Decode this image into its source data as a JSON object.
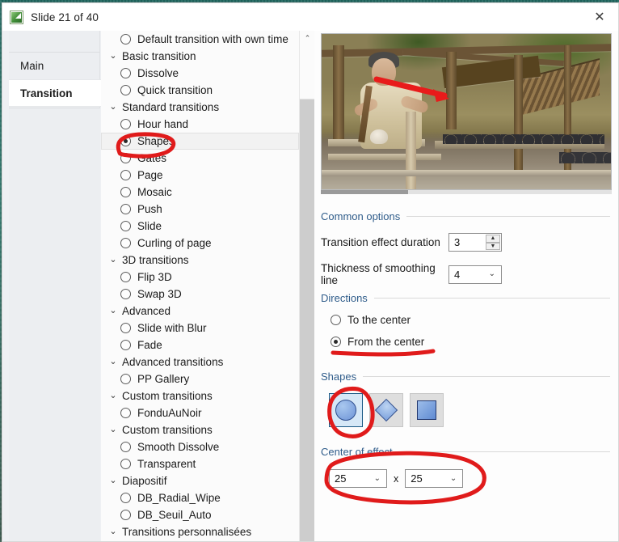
{
  "window": {
    "title": "Slide 21 of 40",
    "title_icon": "slide-thumbnail-icon",
    "close_label": "✕"
  },
  "tabs": [
    {
      "label": "Main",
      "active": false,
      "name": "tab-main"
    },
    {
      "label": "Transition",
      "active": true,
      "name": "tab-transition"
    }
  ],
  "tree": {
    "scroll_up_glyph": "⌃",
    "chevron_glyph": "⌄",
    "rows": [
      {
        "type": "item",
        "label": "Default transition with own time",
        "selected": false
      },
      {
        "type": "group",
        "label": "Basic transition"
      },
      {
        "type": "item",
        "label": "Dissolve",
        "selected": false
      },
      {
        "type": "item",
        "label": "Quick transition",
        "selected": false
      },
      {
        "type": "group",
        "label": "Standard transitions"
      },
      {
        "type": "item",
        "label": "Hour hand",
        "selected": false
      },
      {
        "type": "item",
        "label": "Shapes",
        "selected": true
      },
      {
        "type": "item",
        "label": "Gates",
        "selected": false
      },
      {
        "type": "item",
        "label": "Page",
        "selected": false
      },
      {
        "type": "item",
        "label": "Mosaic",
        "selected": false
      },
      {
        "type": "item",
        "label": "Push",
        "selected": false
      },
      {
        "type": "item",
        "label": "Slide",
        "selected": false
      },
      {
        "type": "item",
        "label": "Curling of page",
        "selected": false
      },
      {
        "type": "group",
        "label": "3D transitions"
      },
      {
        "type": "item",
        "label": "Flip 3D",
        "selected": false
      },
      {
        "type": "item",
        "label": "Swap 3D",
        "selected": false
      },
      {
        "type": "group",
        "label": "Advanced"
      },
      {
        "type": "item",
        "label": "Slide with Blur",
        "selected": false
      },
      {
        "type": "item",
        "label": "Fade",
        "selected": false
      },
      {
        "type": "group",
        "label": "Advanced transitions"
      },
      {
        "type": "item",
        "label": "PP Gallery",
        "selected": false
      },
      {
        "type": "group",
        "label": "Custom transitions"
      },
      {
        "type": "item",
        "label": "FonduAuNoir",
        "selected": false
      },
      {
        "type": "group",
        "label": "Custom transitions"
      },
      {
        "type": "item",
        "label": "Smooth Dissolve",
        "selected": false
      },
      {
        "type": "item",
        "label": "Transparent",
        "selected": false
      },
      {
        "type": "group",
        "label": "Diapositif"
      },
      {
        "type": "item",
        "label": "DB_Radial_Wipe",
        "selected": false
      },
      {
        "type": "item",
        "label": "DB_Seuil_Auto",
        "selected": false
      },
      {
        "type": "group",
        "label": "Transitions personnalisées"
      }
    ]
  },
  "preview": {
    "alt": "potter working at an outdoor wooden workshop with clay pots",
    "annotation": "red-arrow"
  },
  "sections": {
    "common_options": {
      "title": "Common options",
      "duration_label": "Transition effect duration",
      "duration_value": "3",
      "spin_up": "▲",
      "spin_down": "▼",
      "thickness_label": "Thickness of smoothing line",
      "thickness_value": "4"
    },
    "directions": {
      "title": "Directions",
      "options": [
        {
          "label": "To the center",
          "selected": false
        },
        {
          "label": "From the center",
          "selected": true
        }
      ]
    },
    "shapes": {
      "title": "Shapes",
      "buttons": [
        {
          "icon": "circle-shape-icon",
          "selected": true
        },
        {
          "icon": "diamond-shape-icon",
          "selected": false
        },
        {
          "icon": "square-shape-icon",
          "selected": false
        }
      ]
    },
    "center_of_effect": {
      "title": "Center of effect",
      "x_value": "25",
      "separator": "x",
      "y_value": "25",
      "caret": "⌄"
    }
  },
  "colors": {
    "section_title": "#2f5c8a",
    "annotation_red": "#e01b1b",
    "selected_shape_border": "#1b5a86",
    "desktop": "#2b6b63"
  }
}
